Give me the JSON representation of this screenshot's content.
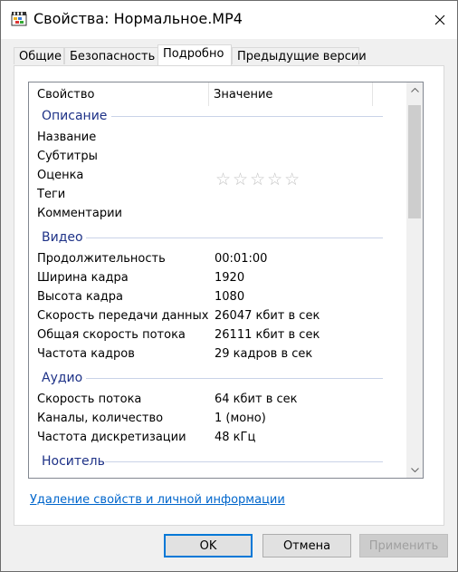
{
  "window": {
    "title": "Свойства: Нормальное.MP4",
    "icon": "video-file-icon"
  },
  "tabs": [
    {
      "label": "Общие"
    },
    {
      "label": "Безопасность"
    },
    {
      "label": "Подробно",
      "active": true
    },
    {
      "label": "Предыдущие версии"
    }
  ],
  "columns": {
    "property": "Свойство",
    "value": "Значение"
  },
  "groups": {
    "description": {
      "title": "Описание",
      "props": [
        {
          "name": "Название",
          "value": ""
        },
        {
          "name": "Субтитры",
          "value": ""
        },
        {
          "name": "Оценка",
          "value": ""
        },
        {
          "name": "Теги",
          "value": ""
        },
        {
          "name": "Комментарии",
          "value": ""
        }
      ],
      "rating": {
        "stars": "☆☆☆☆☆",
        "value": 0,
        "max": 5
      }
    },
    "video": {
      "title": "Видео",
      "props": [
        {
          "name": "Продолжительность",
          "value": "00:01:00"
        },
        {
          "name": "Ширина кадра",
          "value": "1920"
        },
        {
          "name": "Высота кадра",
          "value": "1080"
        },
        {
          "name": "Скорость передачи данных",
          "value": "26047 кбит в сек"
        },
        {
          "name": "Общая скорость потока",
          "value": "26111 кбит в сек"
        },
        {
          "name": "Частота кадров",
          "value": "29 кадров в сек"
        }
      ]
    },
    "audio": {
      "title": "Аудио",
      "props": [
        {
          "name": "Скорость потока",
          "value": "64 кбит в сек"
        },
        {
          "name": "Каналы, количество",
          "value": "1 (моно)"
        },
        {
          "name": "Частота дискретизации",
          "value": "48 кГц"
        }
      ]
    },
    "media": {
      "title": "Носитель"
    }
  },
  "link": {
    "label": "Удаление свойств и личной информации"
  },
  "buttons": {
    "ok": "OK",
    "cancel": "Отмена",
    "apply": "Применить"
  },
  "colors": {
    "group_title": "#1e3287",
    "link": "#0066cc",
    "default_button_border": "#0078d7"
  }
}
